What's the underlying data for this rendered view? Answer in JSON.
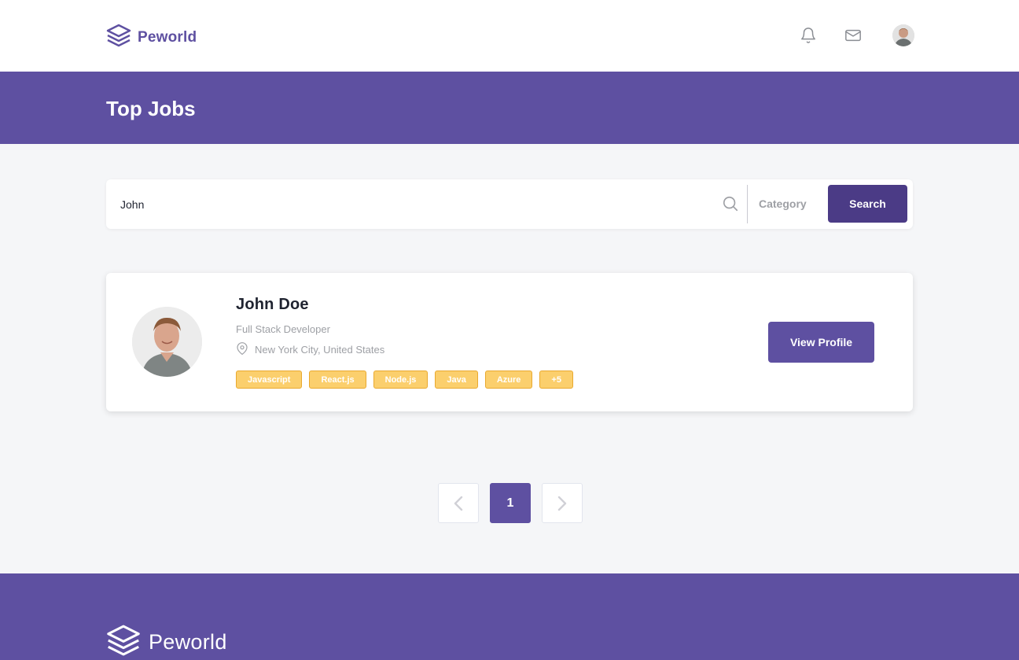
{
  "navbar": {
    "brand": "Peworld",
    "icons": [
      "bell-icon",
      "mail-icon",
      "avatar"
    ]
  },
  "banner": {
    "title": "Top Jobs"
  },
  "search": {
    "value": "John",
    "placeholder": "",
    "category_label": "Category",
    "button_label": "Search"
  },
  "results": [
    {
      "name": "John Doe",
      "role": "Full Stack Developer",
      "location": "New York City, United States",
      "skills": [
        "Javascript",
        "React.js",
        "Node.js",
        "Java",
        "Azure",
        "+5"
      ],
      "button_label": "View Profile"
    }
  ],
  "pagination": {
    "prev": "‹",
    "current": "1",
    "next": "›"
  },
  "footer": {
    "brand": "Peworld"
  },
  "colors": {
    "primary": "#5e50a1",
    "dark_primary": "#4b3b86",
    "skill_bg": "#fbcf6d",
    "skill_border": "#e9a92f",
    "page_bg": "#f5f6f8"
  }
}
